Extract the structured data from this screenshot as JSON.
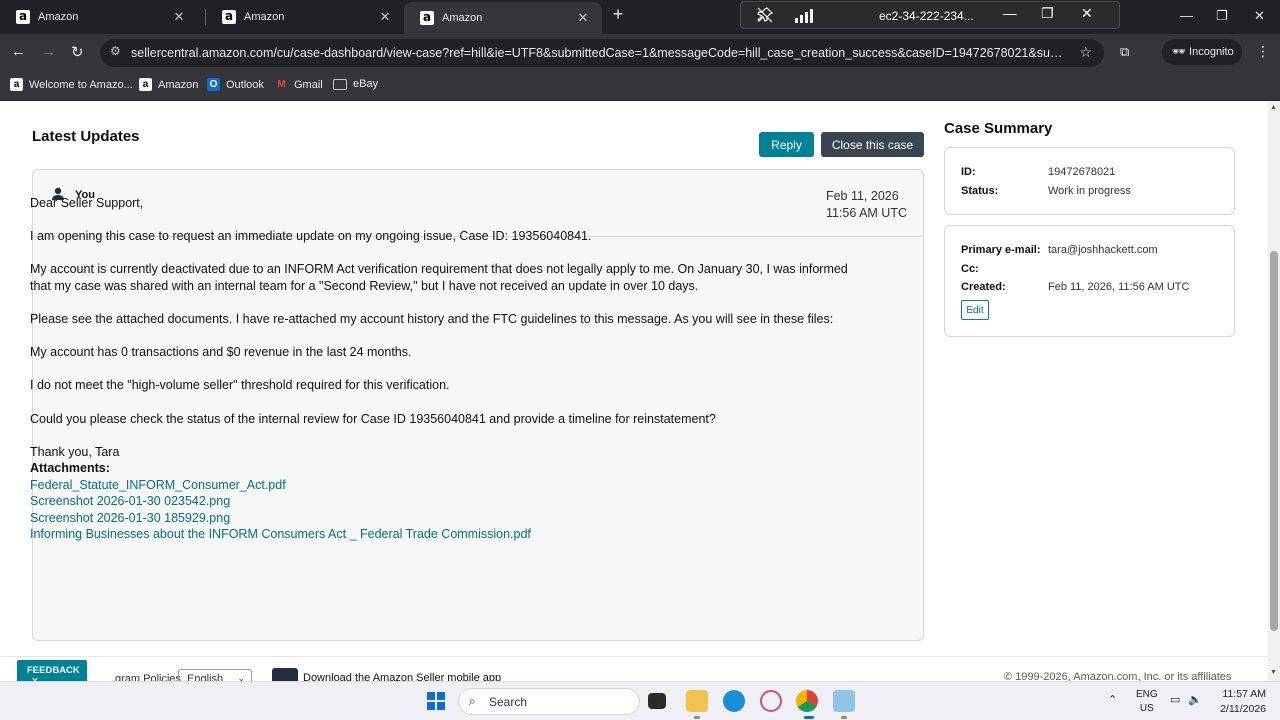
{
  "browser": {
    "tabs": [
      {
        "title": "Amazon",
        "active": false
      },
      {
        "title": "Amazon",
        "active": false
      },
      {
        "title": "Amazon",
        "active": true
      }
    ],
    "url": "sellercentral.amazon.com/cu/case-dashboard/view-case?ref=hill&ie=UTF8&submittedCase=1&messageCode=hill_case_creation_success&caseID=19472678021&successMessage=...",
    "incognito_label": "Incognito",
    "bookmarks": [
      {
        "label": "Welcome to Amazo..."
      },
      {
        "label": "Amazon"
      },
      {
        "label": "Outlook"
      },
      {
        "label": "Gmail"
      },
      {
        "label": "eBay"
      }
    ]
  },
  "remote_session": {
    "host": "ec2-34-222-234..."
  },
  "updates": {
    "title": "Latest Updates",
    "reply_label": "Reply",
    "close_label": "Close this case",
    "message": {
      "author": "You",
      "date": "Feb 11, 2026",
      "time": "11:56 AM UTC",
      "paragraphs": [
        "Dear Seller Support,",
        "I am opening this case to request an immediate update on my ongoing issue, Case ID: 19356040841.",
        "My account is currently deactivated due to an INFORM Act verification requirement that does not legally apply to me. On January 30, I was informed that my case was shared with an internal team for a \"Second Review,\" but I have not received an update in over 10 days.",
        "Please see the attached documents. I have re-attached my account history and the FTC guidelines to this message. As you will see in these files:",
        "My account has 0 transactions and $0 revenue in the last 24 months.",
        "I do not meet the \"high-volume seller\" threshold required for this verification.",
        "Could you please check the status of the internal review for Case ID 19356040841 and provide a timeline for reinstatement?"
      ],
      "signoff": "Thank you, Tara",
      "attachments_label": "Attachments:",
      "attachments": [
        "Federal_Statute_INFORM_Consumer_Act.pdf",
        "Screenshot 2026-01-30 023542.png",
        "Screenshot 2026-01-30 185929.png",
        "Informing Businesses about the INFORM Consumers Act _ Federal Trade Commission.pdf"
      ]
    }
  },
  "summary": {
    "title": "Case Summary",
    "id_label": "ID:",
    "id_value": "19472678021",
    "status_label": "Status:",
    "status_value": "Work in progress",
    "email_label": "Primary e-mail:",
    "email_value": "tara@joshhackett.com",
    "cc_label": "Cc:",
    "cc_value": "",
    "created_label": "Created:",
    "created_value": "Feb 11, 2026, 11:56 AM UTC",
    "edit_label": "Edit"
  },
  "footer": {
    "policies": "gram Policies",
    "language": "English",
    "app_link": "Download the Amazon Seller mobile app",
    "copyright": "© 1999-2026, Amazon.com, Inc. or its affiliates",
    "feedback": "FEEDBACK"
  },
  "taskbar": {
    "search_placeholder": "Search",
    "lang_top": "ENG",
    "lang_bottom": "US",
    "time": "11:57 AM",
    "date": "2/11/2026"
  },
  "colors": {
    "accent": "#008296",
    "link": "#007185",
    "dark_button": "#3a4553"
  }
}
